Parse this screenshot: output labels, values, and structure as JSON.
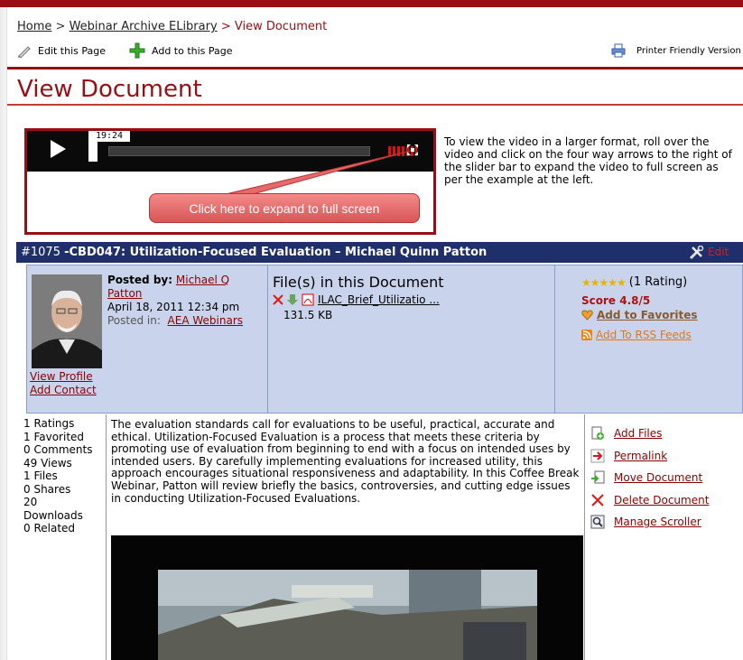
{
  "breadcrumb": {
    "home": "Home",
    "sep1": ">",
    "library": "Webinar Archive ELibrary",
    "sep2": ">",
    "current": "View Document"
  },
  "toolbar": {
    "edit_page": "Edit this Page",
    "add_page": "Add to this Page",
    "printer": "Printer Friendly Version"
  },
  "page_title": "View Document",
  "player": {
    "time": "19:24",
    "callout": "Click here to expand to full screen"
  },
  "help_text": "To view the video in a larger format, roll over the video and click on the four way arrows to the right of the slider bar to expand the video to full screen as per the example at the left.",
  "doc": {
    "number": "#1075",
    "title": "-CBD047: Utilization-Focused Evaluation – Michael Quinn Patton",
    "edit": "Edit"
  },
  "posted": {
    "label": "Posted by:",
    "author": "Michael Q Patton",
    "date": "April 18, 2011 12:34 pm",
    "posted_in_label": "Posted in:",
    "category": "AEA Webinars",
    "view_profile": "View Profile",
    "add_contact": "Add Contact"
  },
  "files": {
    "heading": "File(s) in this Document",
    "file_name": "ILAC_Brief_Utilizatio ...",
    "file_size": "131.5 KB"
  },
  "rating": {
    "stars": "★★★★★",
    "count": "(1 Rating)",
    "score": "Score 4.8/5",
    "favorites": "Add to Favorites",
    "rss": "Add To RSS Feeds"
  },
  "stats": [
    "1 Ratings",
    "1 Favorited",
    "0 Comments",
    "49 Views",
    "1 Files",
    "0 Shares",
    "20",
    "Downloads",
    "0 Related"
  ],
  "description": "The evaluation standards call for evaluations to be useful, practical, accurate and ethical. Utilization-Focused Evaluation is a process that meets these criteria by promoting use of evaluation from beginning to end with a focus on intended uses by intended users. By carefully implementing evaluations for increased utility, this approach encourages situational responsiveness and adaptability. In this Coffee Break Webinar, Patton will review briefly the basics, controversies, and cutting edge issues in conducting Utilization-Focused Evaluations.",
  "actions": [
    "Add Files",
    "Permalink",
    "Move Document",
    "Delete Document",
    "Manage Scroller"
  ],
  "colors": {
    "brand_red": "#9b0d14",
    "doc_bar_blue": "#1e2f6b",
    "panel_blue": "#c9d4ec",
    "link_red": "#8b0000"
  }
}
